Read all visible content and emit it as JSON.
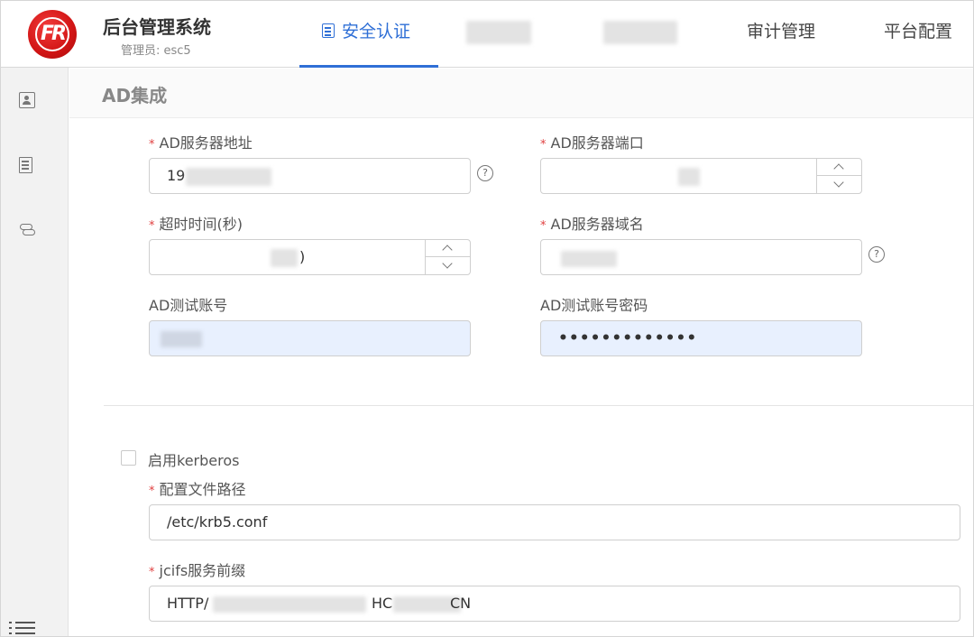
{
  "header": {
    "title": "后台管理系统",
    "admin": "管理员: esc5",
    "tabs": [
      {
        "label": "安全认证",
        "active": true
      },
      {
        "label": "",
        "redacted": true
      },
      {
        "label": "",
        "redacted": true
      },
      {
        "label": "审计管理",
        "active": false
      },
      {
        "label": "平台配置",
        "active": false
      }
    ]
  },
  "sidebar": {
    "items": [
      {
        "icon": "user-card-icon"
      },
      {
        "icon": "document-icon"
      },
      {
        "icon": "link-icon"
      }
    ],
    "collapse_icon": "list-icon"
  },
  "main": {
    "section_title": "AD集成",
    "fields": {
      "server_address": {
        "label": "AD服务器地址",
        "required": true,
        "value": "19",
        "help": "?"
      },
      "server_port": {
        "label": "AD服务器端口",
        "required": true,
        "value": ""
      },
      "timeout": {
        "label": "超时时间(秒)",
        "required": true,
        "value": ")"
      },
      "server_domain": {
        "label": "AD服务器域名",
        "required": true,
        "value": "",
        "help": "?"
      },
      "test_account": {
        "label": "AD测试账号",
        "required": false,
        "value": ""
      },
      "test_password": {
        "label": "AD测试账号密码",
        "required": false,
        "value": "•••••••••••••"
      }
    },
    "kerberos": {
      "checkbox_label": "启用kerberos",
      "checked": false,
      "config_path": {
        "label": "配置文件路径",
        "required": true,
        "value": "/etc/krb5.conf"
      },
      "jcifs_prefix": {
        "label": "jcifs服务前缀",
        "required": true,
        "value_prefix": "HTTP/",
        "value_mid": "HC",
        "value_suffix": "CN"
      }
    },
    "required_mark": "*"
  },
  "colors": {
    "accent": "#2f6fd6",
    "required": "#e04040",
    "autofill": "#e8f0fe",
    "logo": "#d11414"
  }
}
